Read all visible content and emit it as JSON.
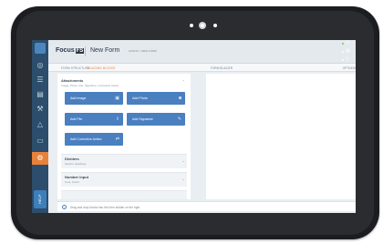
{
  "app": {
    "brand": "Focus",
    "brand_box": "FS",
    "page_title": "New Form",
    "breadcrumb": "ACNOS > NEW FORM"
  },
  "tabs": {
    "structure": "FORM STRUCTURE",
    "building_blocks": "BUILDING BLOCKS",
    "form_builder": "FORM BUILDER",
    "options": "OPTIONS"
  },
  "sections": {
    "attachments": {
      "title": "Attachments",
      "subtitle": "Image, Photo, File, Signature, Corrective Action",
      "buttons": {
        "image": "Add Image",
        "photo": "Add Photo",
        "file": "Add File",
        "signature": "Add Signature",
        "corrective_action": "Add Corrective Action"
      }
    },
    "dividers": {
      "title": "Dividers",
      "subtitle": "Section Headings"
    },
    "number_input": {
      "title": "Number Input",
      "subtitle": "Cost, Count"
    }
  },
  "footer": {
    "hint": "Drag and drop blocks into the form builder on the right."
  },
  "rail": {
    "help_label": "HELP"
  },
  "colors": {
    "accent": "#e8813a",
    "primary": "#4a7fc0",
    "rail": "#2c4d6c"
  },
  "icons": {
    "rail": [
      "dashboard-icon",
      "list-icon",
      "doc-icon",
      "tools-icon",
      "alert-icon",
      "chat-icon",
      "gear-icon"
    ],
    "buttons": [
      "image-icon",
      "camera-icon",
      "upload-icon",
      "signature-icon",
      "shuffle-icon"
    ]
  }
}
